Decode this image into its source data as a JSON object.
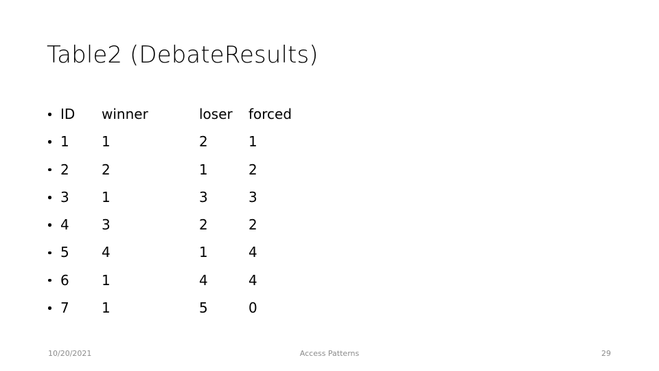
{
  "slide": {
    "title": "Table2 (DebateResults)"
  },
  "table": {
    "columns": [
      "ID",
      "winner",
      "loser",
      "forced"
    ],
    "header": {
      "id": "ID",
      "winner": "winner",
      "loser": "loser",
      "forced": "forced"
    },
    "rows": [
      {
        "id": "1",
        "winner": "1",
        "loser": "2",
        "forced": "1"
      },
      {
        "id": "2",
        "winner": "2",
        "loser": "1",
        "forced": "2"
      },
      {
        "id": "3",
        "winner": "1",
        "loser": "3",
        "forced": "3"
      },
      {
        "id": "4",
        "winner": "3",
        "loser": "2",
        "forced": "2"
      },
      {
        "id": "5",
        "winner": "4",
        "loser": "1",
        "forced": "4"
      },
      {
        "id": "6",
        "winner": "1",
        "loser": "4",
        "forced": "4"
      },
      {
        "id": "7",
        "winner": "1",
        "loser": "5",
        "forced": "0"
      }
    ]
  },
  "footer": {
    "date": "10/20/2021",
    "center": "Access Patterns",
    "page_number": "29"
  },
  "colors": {
    "background": "#ffffff",
    "text": "#000000",
    "footer_text": "#8c8c8c"
  }
}
